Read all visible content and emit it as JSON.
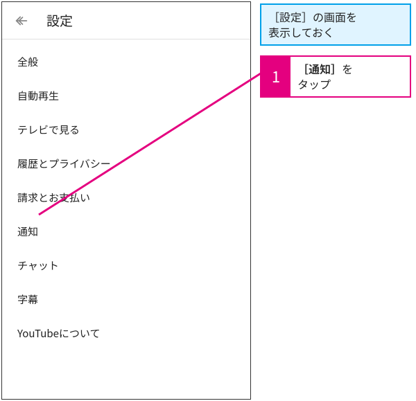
{
  "header": {
    "title": "設定"
  },
  "menu": {
    "items": [
      {
        "label": "全般"
      },
      {
        "label": "自動再生"
      },
      {
        "label": "テレビで見る"
      },
      {
        "label": "履歴とプライバシー"
      },
      {
        "label": "請求とお支払い"
      },
      {
        "label": "通知"
      },
      {
        "label": "チャット"
      },
      {
        "label": "字幕"
      },
      {
        "label": "YouTubeについて"
      }
    ]
  },
  "callout_note": {
    "line1": "［設定］の画面を",
    "line2": "表示しておく"
  },
  "callout_step": {
    "number": "1",
    "text_bold": "［通知］",
    "text_rest1": "を",
    "text_rest2": "タップ"
  },
  "colors": {
    "accent_pink": "#e4007f",
    "accent_blue": "#00a0e9",
    "note_bg": "#e0f4ff"
  }
}
